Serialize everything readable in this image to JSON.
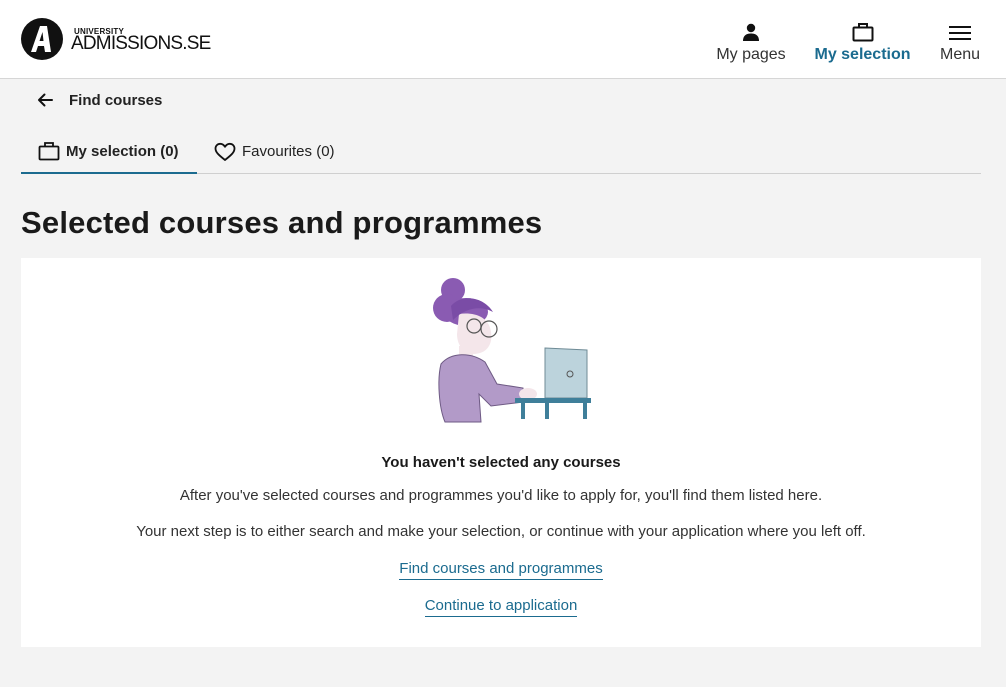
{
  "header": {
    "logo_small": "UNIVERSITY",
    "logo_big": "ADMISSIONS.SE",
    "nav": {
      "my_pages": "My pages",
      "my_selection": "My selection",
      "menu": "Menu"
    }
  },
  "back_link": {
    "label": "Find courses"
  },
  "tabs": {
    "my_selection": "My selection (0)",
    "favourites": "Favourites (0)"
  },
  "main": {
    "title": "Selected courses and programmes",
    "empty_title": "You haven't selected any courses",
    "empty_text_1": "After you've selected courses and programmes you'd like to apply for, you'll find them listed here.",
    "empty_text_2": "Your next step is to either search and make your selection, or continue with your application where you left off.",
    "link_find": "Find courses and programmes",
    "link_continue": "Continue to application"
  },
  "colors": {
    "accent": "#1b6b8f",
    "background": "#f3f3f3",
    "illustration_hair": "#8a5bb2",
    "illustration_shirt": "#b29ac8",
    "illustration_laptop": "#bcd3dc",
    "illustration_desk": "#3f7f9a"
  },
  "icons": {
    "logo": "admissions-a-logo",
    "my_pages": "person-icon",
    "my_selection": "briefcase-icon",
    "menu": "hamburger-icon",
    "back": "arrow-left-icon",
    "favourites": "heart-icon"
  }
}
